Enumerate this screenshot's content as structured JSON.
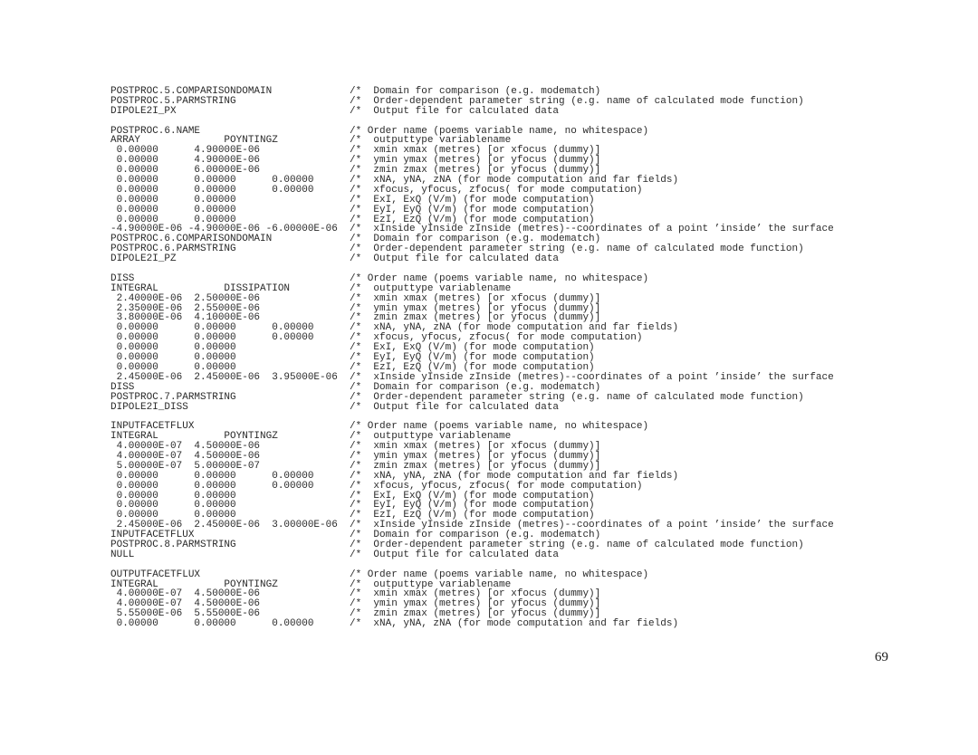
{
  "document": {
    "page_number": "69",
    "lines": [
      {
        "code": "POSTPROC.5.COMPARISONDOMAIN",
        "comment": "/*  Domain for comparison (e.g. modematch)"
      },
      {
        "code": "POSTPROC.5.PARMSTRING",
        "comment": "/*  Order-dependent parameter string (e.g. name of calculated mode function)"
      },
      {
        "code": "DIPOLE2I_PX",
        "comment": "/*  Output file for calculated data"
      },
      {
        "code": "",
        "comment": ""
      },
      {
        "code": "POSTPROC.6.NAME",
        "comment": "/* Order name (poems variable name, no whitespace)"
      },
      {
        "code": "ARRAY              POYNTINGZ",
        "comment": "/*  outputtype variablename"
      },
      {
        "code": " 0.00000      4.90000E-06",
        "comment": "/*  xmin xmax (metres) [or xfocus (dummy)]"
      },
      {
        "code": " 0.00000      4.90000E-06",
        "comment": "/*  ymin ymax (metres) [or yfocus (dummy)]"
      },
      {
        "code": " 0.00000      6.00000E-06",
        "comment": "/*  zmin zmax (metres) [or yfocus (dummy)]"
      },
      {
        "code": " 0.00000      0.00000      0.00000",
        "comment": "/*  xNA, yNA, zNA (for mode computation and far fields)"
      },
      {
        "code": " 0.00000      0.00000      0.00000",
        "comment": "/*  xfocus, yfocus, zfocus( for mode computation)"
      },
      {
        "code": " 0.00000      0.00000",
        "comment": "/*  ExI, ExQ (V/m) (for mode computation)"
      },
      {
        "code": " 0.00000      0.00000",
        "comment": "/*  EyI, EyQ (V/m) (for mode computation)"
      },
      {
        "code": " 0.00000      0.00000",
        "comment": "/*  EzI, EzQ (V/m) (for mode computation)"
      },
      {
        "code": "-4.90000E-06 -4.90000E-06 -6.00000E-06",
        "comment": "/*  xInside yInside zInside (metres)--coordinates of a point ’inside’ the surface"
      },
      {
        "code": "POSTPROC.6.COMPARISONDOMAIN",
        "comment": "/*  Domain for comparison (e.g. modematch)"
      },
      {
        "code": "POSTPROC.6.PARMSTRING",
        "comment": "/*  Order-dependent parameter string (e.g. name of calculated mode function)"
      },
      {
        "code": "DIPOLE2I_PZ",
        "comment": "/*  Output file for calculated data"
      },
      {
        "code": "",
        "comment": ""
      },
      {
        "code": "DISS",
        "comment": "/* Order name (poems variable name, no whitespace)"
      },
      {
        "code": "INTEGRAL           DISSIPATION",
        "comment": "/*  outputtype variablename"
      },
      {
        "code": " 2.40000E-06  2.50000E-06",
        "comment": "/*  xmin xmax (metres) [or xfocus (dummy)]"
      },
      {
        "code": " 2.35000E-06  2.55000E-06",
        "comment": "/*  ymin ymax (metres) [or yfocus (dummy)]"
      },
      {
        "code": " 3.80000E-06  4.10000E-06",
        "comment": "/*  zmin zmax (metres) [or yfocus (dummy)]"
      },
      {
        "code": " 0.00000      0.00000      0.00000",
        "comment": "/*  xNA, yNA, zNA (for mode computation and far fields)"
      },
      {
        "code": " 0.00000      0.00000      0.00000",
        "comment": "/*  xfocus, yfocus, zfocus( for mode computation)"
      },
      {
        "code": " 0.00000      0.00000",
        "comment": "/*  ExI, ExQ (V/m) (for mode computation)"
      },
      {
        "code": " 0.00000      0.00000",
        "comment": "/*  EyI, EyQ (V/m) (for mode computation)"
      },
      {
        "code": " 0.00000      0.00000",
        "comment": "/*  EzI, EzQ (V/m) (for mode computation)"
      },
      {
        "code": " 2.45000E-06  2.45000E-06  3.95000E-06",
        "comment": "/*  xInside yInside zInside (metres)--coordinates of a point ’inside’ the surface"
      },
      {
        "code": "DISS",
        "comment": "/*  Domain for comparison (e.g. modematch)"
      },
      {
        "code": "POSTPROC.7.PARMSTRING",
        "comment": "/*  Order-dependent parameter string (e.g. name of calculated mode function)"
      },
      {
        "code": "DIPOLE2I_DISS",
        "comment": "/*  Output file for calculated data"
      },
      {
        "code": "",
        "comment": ""
      },
      {
        "code": "INPUTFACETFLUX",
        "comment": "/* Order name (poems variable name, no whitespace)"
      },
      {
        "code": "INTEGRAL           POYNTINGZ",
        "comment": "/*  outputtype variablename"
      },
      {
        "code": " 4.00000E-07  4.50000E-06",
        "comment": "/*  xmin xmax (metres) [or xfocus (dummy)]"
      },
      {
        "code": " 4.00000E-07  4.50000E-06",
        "comment": "/*  ymin ymax (metres) [or yfocus (dummy)]"
      },
      {
        "code": " 5.00000E-07  5.00000E-07",
        "comment": "/*  zmin zmax (metres) [or yfocus (dummy)]"
      },
      {
        "code": " 0.00000      0.00000      0.00000",
        "comment": "/*  xNA, yNA, zNA (for mode computation and far fields)"
      },
      {
        "code": " 0.00000      0.00000      0.00000",
        "comment": "/*  xfocus, yfocus, zfocus( for mode computation)"
      },
      {
        "code": " 0.00000      0.00000",
        "comment": "/*  ExI, ExQ (V/m) (for mode computation)"
      },
      {
        "code": " 0.00000      0.00000",
        "comment": "/*  EyI, EyQ (V/m) (for mode computation)"
      },
      {
        "code": " 0.00000      0.00000",
        "comment": "/*  EzI, EzQ (V/m) (for mode computation)"
      },
      {
        "code": " 2.45000E-06  2.45000E-06  3.00000E-06",
        "comment": "/*  xInside yInside zInside (metres)--coordinates of a point ’inside’ the surface"
      },
      {
        "code": "INPUTFACETFLUX",
        "comment": "/*  Domain for comparison (e.g. modematch)"
      },
      {
        "code": "POSTPROC.8.PARMSTRING",
        "comment": "/*  Order-dependent parameter string (e.g. name of calculated mode function)"
      },
      {
        "code": "NULL",
        "comment": "/*  Output file for calculated data"
      },
      {
        "code": "",
        "comment": ""
      },
      {
        "code": "OUTPUTFACETFLUX",
        "comment": "/* Order name (poems variable name, no whitespace)"
      },
      {
        "code": "INTEGRAL           POYNTINGZ",
        "comment": "/*  outputtype variablename"
      },
      {
        "code": " 4.00000E-07  4.50000E-06",
        "comment": "/*  xmin xmax (metres) [or xfocus (dummy)]"
      },
      {
        "code": " 4.00000E-07  4.50000E-06",
        "comment": "/*  ymin ymax (metres) [or yfocus (dummy)]"
      },
      {
        "code": " 5.55000E-06  5.55000E-06",
        "comment": "/*  zmin zmax (metres) [or yfocus (dummy)]"
      },
      {
        "code": " 0.00000      0.00000      0.00000",
        "comment": "/*  xNA, yNA, zNA (for mode computation and far fields)"
      }
    ]
  }
}
